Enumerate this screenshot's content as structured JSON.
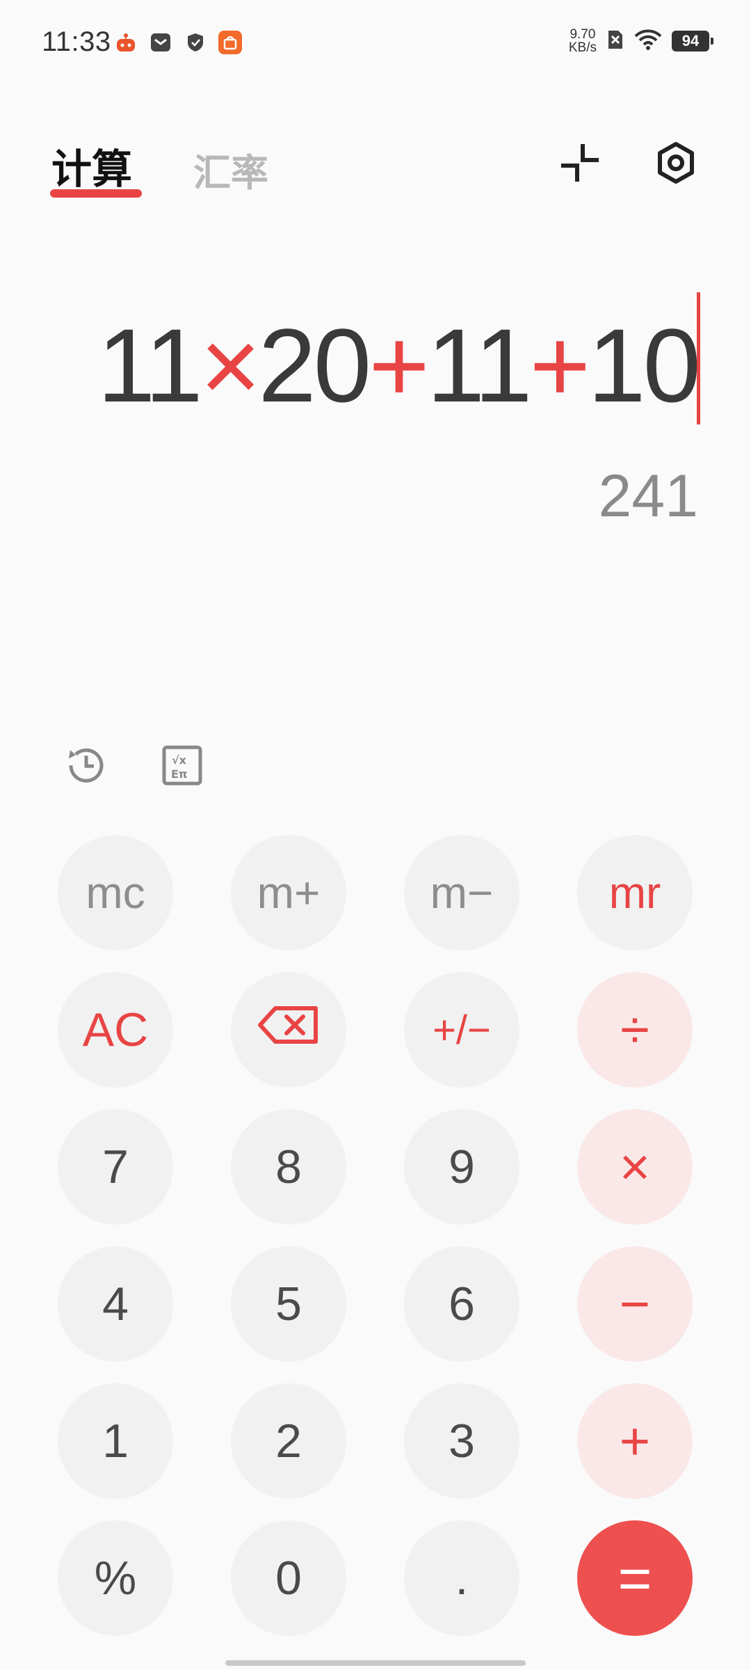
{
  "status_bar": {
    "time": "11:33",
    "net_speed_value": "9.70",
    "net_speed_unit": "KB/s",
    "battery_level": "94",
    "icons": [
      "robot-app-icon",
      "message-icon",
      "shield-icon",
      "shopping-app-icon",
      "sim-disabled-icon",
      "wifi-icon",
      "battery-icon"
    ]
  },
  "header": {
    "tab_calculate": "计算",
    "tab_exchange_rate": "汇率",
    "active_tab": "计算",
    "accent_color": "#e84444"
  },
  "display": {
    "expression_tokens": [
      {
        "text": "11",
        "type": "num"
      },
      {
        "text": "×",
        "type": "op"
      },
      {
        "text": "20",
        "type": "num"
      },
      {
        "text": "+",
        "type": "op"
      },
      {
        "text": "11",
        "type": "num"
      },
      {
        "text": "+",
        "type": "op"
      },
      {
        "text": "10",
        "type": "num"
      }
    ],
    "result": "241"
  },
  "tools": {
    "history_icon": "history-icon",
    "scientific_icon": "scientific-mode-icon"
  },
  "keys": {
    "mc": "mc",
    "m_plus": "m+",
    "m_minus": "m−",
    "mr": "mr",
    "ac": "AC",
    "backspace": "backspace-icon",
    "plus_minus": "+/−",
    "divide": "÷",
    "seven": "7",
    "eight": "8",
    "nine": "9",
    "multiply": "×",
    "four": "4",
    "five": "5",
    "six": "6",
    "minus": "−",
    "one": "1",
    "two": "2",
    "three": "3",
    "plus": "+",
    "percent": "%",
    "zero": "0",
    "decimal": ".",
    "equals": "="
  }
}
